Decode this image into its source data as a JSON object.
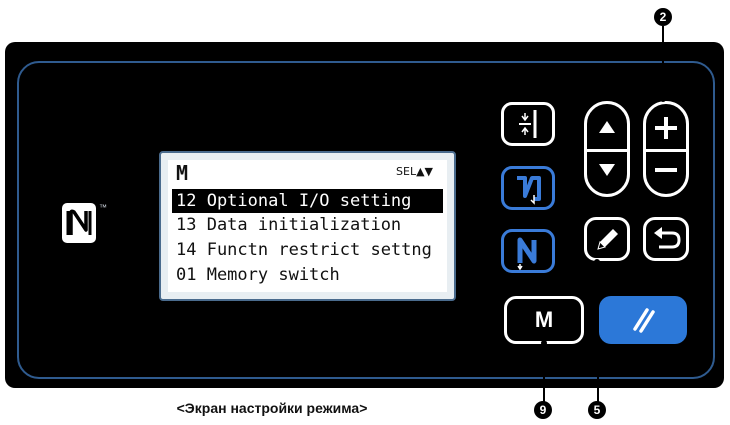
{
  "screen": {
    "header": "M",
    "selector": "SEL▲▼",
    "rows": [
      {
        "text": "12 Optional I/O setting",
        "selected": true
      },
      {
        "text": "13 Data initialization",
        "selected": false
      },
      {
        "text": "14 Functn restrict settng",
        "selected": false
      },
      {
        "text": "01 Memory switch",
        "selected": false
      }
    ]
  },
  "buttons": {
    "m_label": "M"
  },
  "callouts": {
    "plus_minus": "2",
    "edit": "5",
    "mode": "9"
  },
  "caption": "<Экран настройки режима>",
  "colors": {
    "panel": "#000000",
    "panel_border": "#2f5b8f",
    "reset_button": "#2c78d8",
    "threading_icon": "#3a7bd8"
  },
  "icons": {
    "nfc": "nfc-icon",
    "presser_foot": "presser-foot-icon",
    "threading_check": "thread-check-icon",
    "threading": "thread-icon",
    "up": "arrow-up-icon",
    "down": "arrow-down-icon",
    "plus": "plus-icon",
    "minus": "minus-icon",
    "edit": "pencil-icon",
    "return": "return-icon",
    "reset": "reset-icon"
  }
}
